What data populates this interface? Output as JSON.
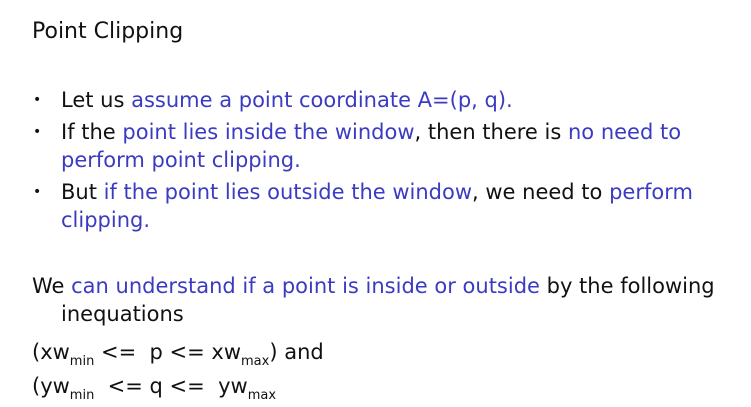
{
  "title": "Point Clipping",
  "bullets": [
    {
      "parts": [
        {
          "text": "Let us ",
          "hl": false
        },
        {
          "text": "assume a point coordinate A=(p, q).",
          "hl": true
        }
      ]
    },
    {
      "parts": [
        {
          "text": "If the ",
          "hl": false
        },
        {
          "text": "point lies inside the window",
          "hl": true
        },
        {
          "text": ", then there is ",
          "hl": false
        },
        {
          "text": "no need to perform point clipping.",
          "hl": true
        }
      ]
    },
    {
      "parts": [
        {
          "text": "But ",
          "hl": false
        },
        {
          "text": "if the point lies outside the window",
          "hl": true
        },
        {
          "text": ", we need to ",
          "hl": false
        },
        {
          "text": "perform clipping.",
          "hl": true
        }
      ]
    }
  ],
  "paragraph": {
    "before": "We ",
    "highlight": "can understand if a point is inside or outside",
    "after": " by the following",
    "line2": "inequations"
  },
  "inequation1": {
    "open": "(xw",
    "sub1": "min",
    "mid": " <=  p <= xw",
    "sub2": "max",
    "close": ") and"
  },
  "inequation2": {
    "open": "(yw",
    "sub1": "min",
    "mid": "  <= q <=  yw",
    "sub2": "max",
    "close": ""
  },
  "colors": {
    "highlight": "#3b3bc2",
    "text": "#111111"
  }
}
